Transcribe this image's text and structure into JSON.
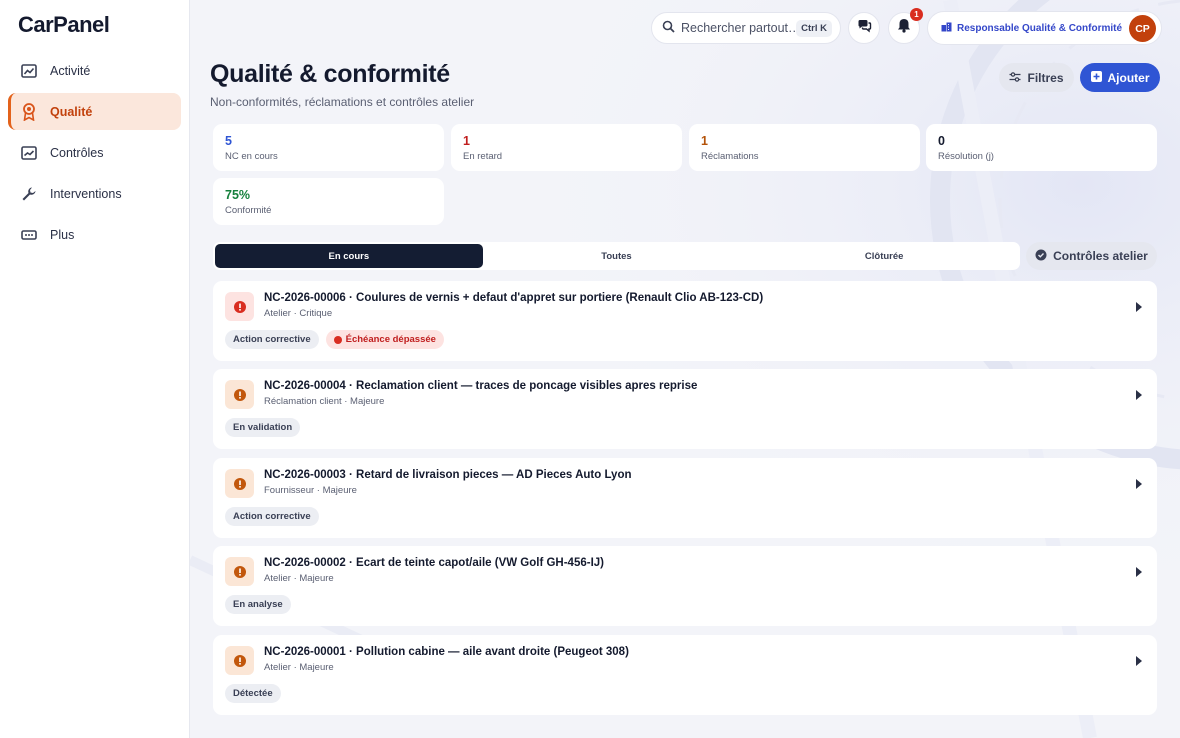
{
  "app": {
    "logo": "CarPanel"
  },
  "sidebar": {
    "items": [
      {
        "label": "Activité",
        "icon": "chart-icon"
      },
      {
        "label": "Qualité",
        "icon": "award-icon",
        "active": true
      },
      {
        "label": "Contrôles",
        "icon": "trend-icon"
      },
      {
        "label": "Interventions",
        "icon": "wrench-icon"
      },
      {
        "label": "Plus",
        "icon": "more-icon"
      }
    ]
  },
  "topbar": {
    "search_placeholder": "Rechercher partout…",
    "search_shortcut": "Ctrl K",
    "notifications_count": "1",
    "role": "Responsable Qualité & Conformité",
    "avatar_initials": "CP"
  },
  "page": {
    "title": "Qualité & conformité",
    "subtitle": "Non-conformités, réclamations et contrôles atelier",
    "filters_label": "Filtres",
    "add_label": "Ajouter"
  },
  "stats": [
    {
      "value": "5",
      "label": "NC en cours",
      "color": "#2f55d4"
    },
    {
      "value": "1",
      "label": "En retard",
      "color": "#c01e1e"
    },
    {
      "value": "1",
      "label": "Réclamations",
      "color": "#b45309"
    },
    {
      "value": "0",
      "label": "Résolution (j)",
      "color": "#141a2e"
    },
    {
      "value": "75%",
      "label": "Conformité",
      "color": "#15803d"
    }
  ],
  "tabs": [
    {
      "label": "En cours",
      "active": true
    },
    {
      "label": "Toutes"
    },
    {
      "label": "Clôturée"
    }
  ],
  "controles_label": "Contrôles atelier",
  "cards": [
    {
      "title": "NC-2026-00006 · Coulures de vernis + defaut d'appret sur portiere (Renault Clio AB-123-CD)",
      "subtitle": "Atelier · Critique",
      "severity": "critical",
      "tags": [
        {
          "label": "Action corrective"
        },
        {
          "label": "Échéance dépassée",
          "danger": true
        }
      ]
    },
    {
      "title": "NC-2026-00004 · Reclamation client — traces de poncage visibles apres reprise",
      "subtitle": "Réclamation client · Majeure",
      "severity": "major",
      "tags": [
        {
          "label": "En validation"
        }
      ]
    },
    {
      "title": "NC-2026-00003 · Retard de livraison pieces — AD Pieces Auto Lyon",
      "subtitle": "Fournisseur · Majeure",
      "severity": "major",
      "tags": [
        {
          "label": "Action corrective"
        }
      ]
    },
    {
      "title": "NC-2026-00002 · Ecart de teinte capot/aile (VW Golf GH-456-IJ)",
      "subtitle": "Atelier · Majeure",
      "severity": "major",
      "tags": [
        {
          "label": "En analyse"
        }
      ]
    },
    {
      "title": "NC-2026-00001 · Pollution cabine — aile avant droite (Peugeot 308)",
      "subtitle": "Atelier · Majeure",
      "severity": "major",
      "tags": [
        {
          "label": "Détectée"
        }
      ]
    }
  ],
  "colors": {
    "accent": "#2f55d4",
    "active_nav": "#e3621b",
    "critical": "#d92d20",
    "major": "#c2570c"
  }
}
